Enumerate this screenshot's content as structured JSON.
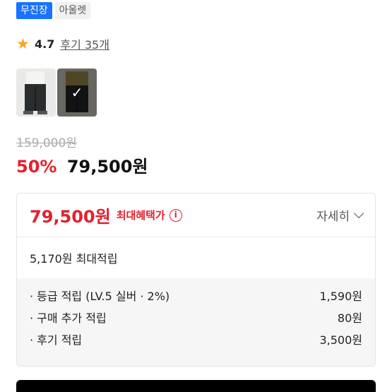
{
  "badges": [
    "무진장",
    "아울렛"
  ],
  "rating": {
    "score": "4.7",
    "review_link": "후기 35개"
  },
  "thumbnails": [
    "thumbnail-light",
    "thumbnail-khaki-selected"
  ],
  "pricing": {
    "original_price": "159,000원",
    "discount": "50%",
    "price": "79,500원"
  },
  "benefit_card": {
    "max_price": "79,500원",
    "max_label": "최대혜택가",
    "info_icon": "i",
    "detail_label": "자세히",
    "points_summary": "5,170원 최대적립",
    "rows": [
      {
        "label": "· 등급 적립 (LV.5 실버 · 2%)",
        "value": "1,590원"
      },
      {
        "label": "· 구매 추가 적립",
        "value": "80원"
      },
      {
        "label": "· 후기 적립",
        "value": "3,500원"
      }
    ]
  },
  "colors": {
    "red": "#e3212e",
    "blue": "#1a73ff",
    "star": "#f6a623"
  }
}
